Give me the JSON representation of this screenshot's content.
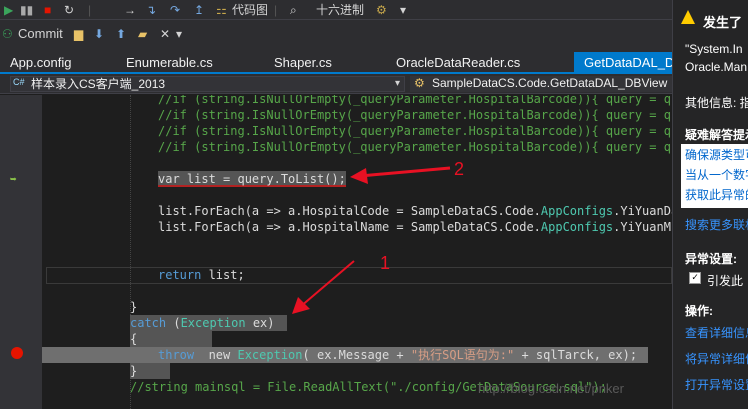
{
  "toolbar": {
    "codemap_label": "代码图",
    "hex_label": "十六进制",
    "commit_label": "Commit"
  },
  "tabs": [
    {
      "label": "App.config"
    },
    {
      "label": "Enumerable.cs"
    },
    {
      "label": "Shaper.cs"
    },
    {
      "label": "OracleDataReader.cs"
    },
    {
      "label": "GetDataDAL_DB"
    }
  ],
  "navbar": {
    "project": "样本录入CS客户端_2013",
    "member": "SampleDataCS.Code.GetDataDAL_DBView"
  },
  "code": {
    "c1": "//if (string.IsNullOrEmpty(_queryParameter.HospitalBarcode)){ query = quer",
    "c2": "//if (string.IsNullOrEmpty(_queryParameter.HospitalBarcode)){ query = quer",
    "c3": "//if (string.IsNullOrEmpty(_queryParameter.HospitalBarcode)){ query = quer",
    "c4": "//if (string.IsNullOrEmpty(_queryParameter.HospitalBarcode)){ query = quer",
    "var_stmt": "var list = query.ToList();",
    "foreach1_a": "list.ForEach(a => a.HospitalCode = SampleDataCS.Code.",
    "foreach1_type": "AppConfigs",
    "foreach1_b": ".YiYuanDail",
    "foreach2_a": "list.ForEach(a => a.HospitalName = SampleDataCS.Code.",
    "foreach2_type": "AppConfigs",
    "foreach2_b": ".YiYuanMing",
    "return_kw": "return",
    "return_rest": " list;",
    "brace_close": "}",
    "catch_kw": "catch",
    "catch_open": " (",
    "catch_type": "Exception",
    "catch_rest": " ex)",
    "brace_open": "{",
    "throw_kw": "throw",
    "throw_mid": "  new ",
    "throw_type": "Exception",
    "throw_args1": "( ex.Message + ",
    "throw_str": "\"执行SQL语句为:\"",
    "throw_args2": " + sqlTarck, ex);",
    "brace_close2": "}",
    "last_comment": "//string mainsql = File.ReadAllText(\"./config/GetDataSource.sql\");"
  },
  "annotations": {
    "label1": "1",
    "label2": "2"
  },
  "popup": {
    "title": "发生了",
    "exception": "\"System.In",
    "source": "Oracle.Man",
    "more_info": "其他信息: 指",
    "troubleshoot": "疑难解答提示",
    "tip1": "确保源类型可",
    "tip2": "当从一个数字",
    "tip3": "获取此异常的",
    "search": "搜索更多联机",
    "settings": "异常设置:",
    "checkbox": "引发此",
    "actions": "操作:",
    "act1": "查看详细信息",
    "act2": "将异常详细信",
    "act3": "打开异常设置"
  },
  "watermark": "http://blog.csdn.net/pnker"
}
